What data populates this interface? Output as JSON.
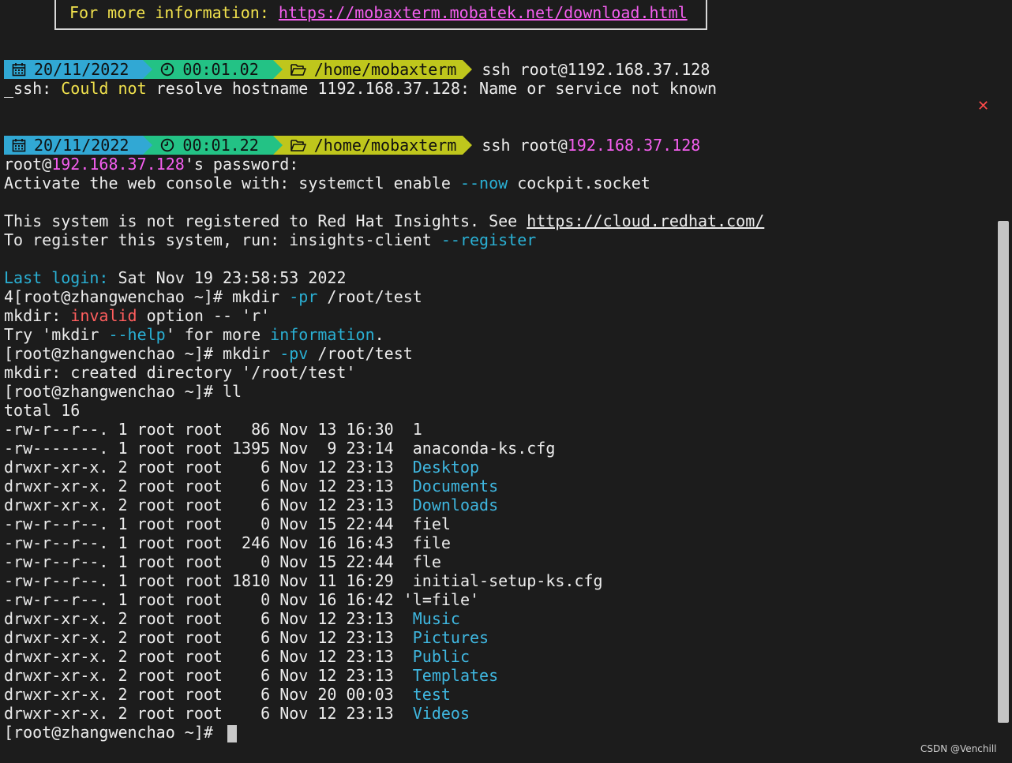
{
  "info": {
    "label": "For more information: ",
    "url": "https://mobaxterm.mobatek.net/download.html"
  },
  "prompt1": {
    "date": "20/11/2022",
    "time": "00:01.02",
    "path": "/home/mobaxterm",
    "command": "ssh root@1192.168.37.128"
  },
  "error": {
    "prefix": "_ssh: ",
    "highlight": "Could not",
    "rest": " resolve hostname 1192.168.37.128: Name or service not known"
  },
  "prompt2": {
    "date": "20/11/2022",
    "time": "00:01.22",
    "path": "/home/mobaxterm",
    "cmd_prefix": "ssh root@",
    "cmd_host": "192.168.37.128"
  },
  "session": {
    "pw_user": "root@",
    "pw_host": "192.168.37.128",
    "pw_rest": "'s password:",
    "activate_1": "Activate the web console with: systemctl enable ",
    "activate_flag": "--now",
    "activate_2": " cockpit.socket",
    "insights_1": "This system is not registered to Red Hat Insights. See ",
    "insights_url": "https://cloud.redhat.com/",
    "register_1": "To register this system, run: insights-client ",
    "register_flag": "--register",
    "last_login_label": "Last login:",
    "last_login_value": " Sat Nov 19 23:58:53 2022",
    "cmd1_prompt": "4[root@zhangwenchao ~]# mkdir ",
    "cmd1_flag": "-pr",
    "cmd1_rest": " /root/test",
    "err1_a": "mkdir: ",
    "err1_b": "invalid",
    "err1_c": " option -- 'r'",
    "try_a": "Try 'mkdir ",
    "try_b": "--help",
    "try_c": "' for more ",
    "try_d": "information",
    "try_e": ".",
    "cmd2_prompt": "[root@zhangwenchao ~]# mkdir ",
    "cmd2_flag": "-pv",
    "cmd2_rest": " /root/test",
    "created": "mkdir: created directory '/root/test'",
    "cmd3": "[root@zhangwenchao ~]# ll",
    "total": "total 16",
    "final_prompt": "[root@zhangwenchao ~]# "
  },
  "listing": [
    {
      "meta": "-rw-r--r--. 1 root root   86 Nov 13 16:30  ",
      "name": "1",
      "dir": false
    },
    {
      "meta": "-rw-------. 1 root root 1395 Nov  9 23:14  ",
      "name": "anaconda-ks.cfg",
      "dir": false
    },
    {
      "meta": "drwxr-xr-x. 2 root root    6 Nov 12 23:13  ",
      "name": "Desktop",
      "dir": true
    },
    {
      "meta": "drwxr-xr-x. 2 root root    6 Nov 12 23:13  ",
      "name": "Documents",
      "dir": true
    },
    {
      "meta": "drwxr-xr-x. 2 root root    6 Nov 12 23:13  ",
      "name": "Downloads",
      "dir": true
    },
    {
      "meta": "-rw-r--r--. 1 root root    0 Nov 15 22:44  ",
      "name": "fiel",
      "dir": false
    },
    {
      "meta": "-rw-r--r--. 1 root root  246 Nov 16 16:43  ",
      "name": "file",
      "dir": false
    },
    {
      "meta": "-rw-r--r--. 1 root root    0 Nov 15 22:44  ",
      "name": "fle",
      "dir": false
    },
    {
      "meta": "-rw-r--r--. 1 root root 1810 Nov 11 16:29  ",
      "name": "initial-setup-ks.cfg",
      "dir": false
    },
    {
      "meta": "-rw-r--r--. 1 root root    0 Nov 16 16:42 ",
      "name": "'l=file'",
      "dir": false
    },
    {
      "meta": "drwxr-xr-x. 2 root root    6 Nov 12 23:13  ",
      "name": "Music",
      "dir": true
    },
    {
      "meta": "drwxr-xr-x. 2 root root    6 Nov 12 23:13  ",
      "name": "Pictures",
      "dir": true
    },
    {
      "meta": "drwxr-xr-x. 2 root root    6 Nov 12 23:13  ",
      "name": "Public",
      "dir": true
    },
    {
      "meta": "drwxr-xr-x. 2 root root    6 Nov 12 23:13  ",
      "name": "Templates",
      "dir": true
    },
    {
      "meta": "drwxr-xr-x. 2 root root    6 Nov 20 00:03  ",
      "name": "test",
      "dir": true
    },
    {
      "meta": "drwxr-xr-x. 2 root root    6 Nov 12 23:13  ",
      "name": "Videos",
      "dir": true
    }
  ],
  "watermark": "CSDN @Venchill",
  "colors": {
    "background": "#1c1c1c",
    "date_segment": "#31a8d4",
    "time_segment": "#23c285",
    "path_segment": "#bfc61c",
    "directory": "#2ab0d4",
    "error": "#ff5e5e",
    "link": "#f55ff0"
  },
  "icons": {
    "date": "calendar-icon",
    "time": "clock-icon",
    "path": "folder-open-icon",
    "close": "close-x-icon"
  }
}
